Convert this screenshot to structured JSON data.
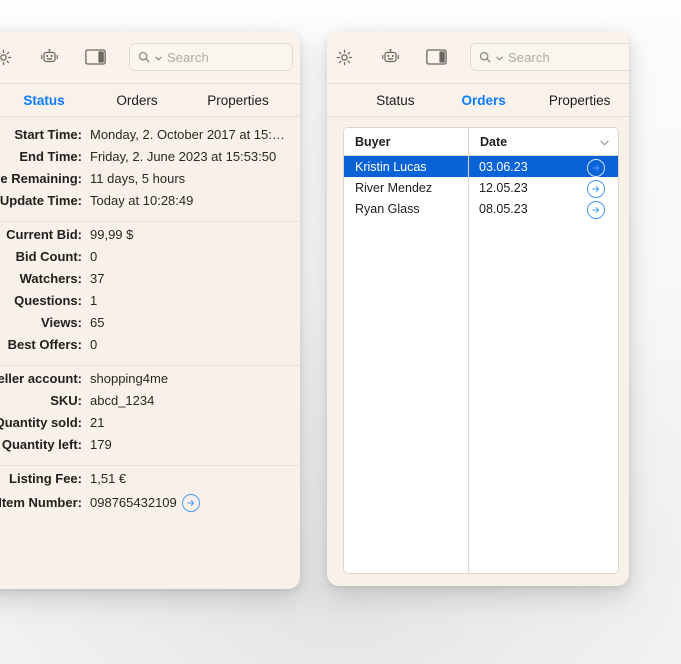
{
  "toolbar": {
    "icons": [
      {
        "name": "gear-icon",
        "label": "Settings"
      },
      {
        "name": "robot-icon",
        "label": "Automation"
      },
      {
        "name": "sidebar-toggle-icon",
        "label": "Toggle Sidebar"
      }
    ],
    "search": {
      "placeholder": "Search",
      "value": "",
      "icon": "search-icon",
      "dropdown_icon": "chevron-down-icon"
    }
  },
  "tabs": [
    "Status",
    "Orders",
    "Properties"
  ],
  "left_panel": {
    "active_tab": "Status",
    "groups": [
      {
        "rows": [
          {
            "label": "Start Time:",
            "value": "Monday, 2. October 2017 at 15:…"
          },
          {
            "label": "End Time:",
            "value": "Friday, 2. June 2023 at 15:53:50"
          },
          {
            "label": "Time Remaining:",
            "value": "11 days, 5 hours"
          },
          {
            "label": "Update Time:",
            "value": "Today at 10:28:49"
          }
        ]
      },
      {
        "rows": [
          {
            "label": "Current Bid:",
            "value": "99,99 $"
          },
          {
            "label": "Bid Count:",
            "value": "0"
          },
          {
            "label": "Watchers:",
            "value": "37"
          },
          {
            "label": "Questions:",
            "value": "1"
          },
          {
            "label": "Views:",
            "value": "65"
          },
          {
            "label": "Best Offers:",
            "value": "0"
          }
        ]
      },
      {
        "rows": [
          {
            "label": "Seller account:",
            "value": "shopping4me"
          },
          {
            "label": "SKU:",
            "value": "abcd_1234"
          },
          {
            "label": "Quantity sold:",
            "value": "21"
          },
          {
            "label": "Quantity left:",
            "value": "179"
          }
        ]
      },
      {
        "rows": [
          {
            "label": "Listing Fee:",
            "value": "1,51 €"
          },
          {
            "label": "Item Number:",
            "value": "098765432109",
            "action_icon": "arrow-right-circle-icon"
          }
        ]
      }
    ]
  },
  "right_panel": {
    "active_tab": "Orders",
    "table": {
      "columns": [
        "Buyer",
        "Date"
      ],
      "sort_icon": "chevron-down-icon",
      "rows": [
        {
          "buyer": "Kristin Lucas",
          "date": "03.06.23",
          "selected": true,
          "action_icon": "arrow-right-circle-icon"
        },
        {
          "buyer": "River Mendez",
          "date": "12.05.23",
          "selected": false,
          "action_icon": "arrow-right-circle-icon"
        },
        {
          "buyer": "Ryan Glass",
          "date": "08.05.23",
          "selected": false,
          "action_icon": "arrow-right-circle-icon"
        }
      ]
    }
  },
  "colors": {
    "accent": "#0a7bff",
    "selection": "#0a63d6",
    "panel_bg": "#f8f1ea",
    "table_bg": "#ffffff"
  }
}
